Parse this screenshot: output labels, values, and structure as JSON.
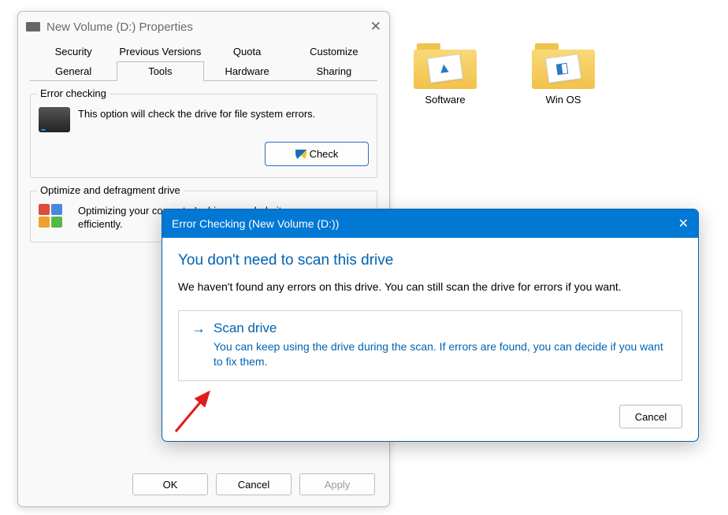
{
  "desktop": {
    "folders": [
      {
        "label": "Software"
      },
      {
        "label": "Win OS"
      }
    ]
  },
  "properties": {
    "title": "New Volume (D:) Properties",
    "tabs_row1": [
      "Security",
      "Previous Versions",
      "Quota",
      "Customize"
    ],
    "tabs_row2": [
      "General",
      "Tools",
      "Hardware",
      "Sharing"
    ],
    "active_tab": "Tools",
    "error_check": {
      "legend": "Error checking",
      "text": "This option will check the drive for file system errors.",
      "button": "Check"
    },
    "optimize": {
      "legend": "Optimize and defragment drive",
      "text": "Optimizing your computer's drives can help it run more efficiently."
    },
    "ok": "OK",
    "cancel": "Cancel",
    "apply": "Apply"
  },
  "dialog": {
    "title": "Error Checking (New Volume (D:))",
    "heading": "You don't need to scan this drive",
    "text": "We haven't found any errors on this drive. You can still scan the drive for errors if you want.",
    "option_title": "Scan drive",
    "option_desc": "You can keep using the drive during the scan. If errors are found, you can decide if you want to fix them.",
    "cancel": "Cancel"
  }
}
